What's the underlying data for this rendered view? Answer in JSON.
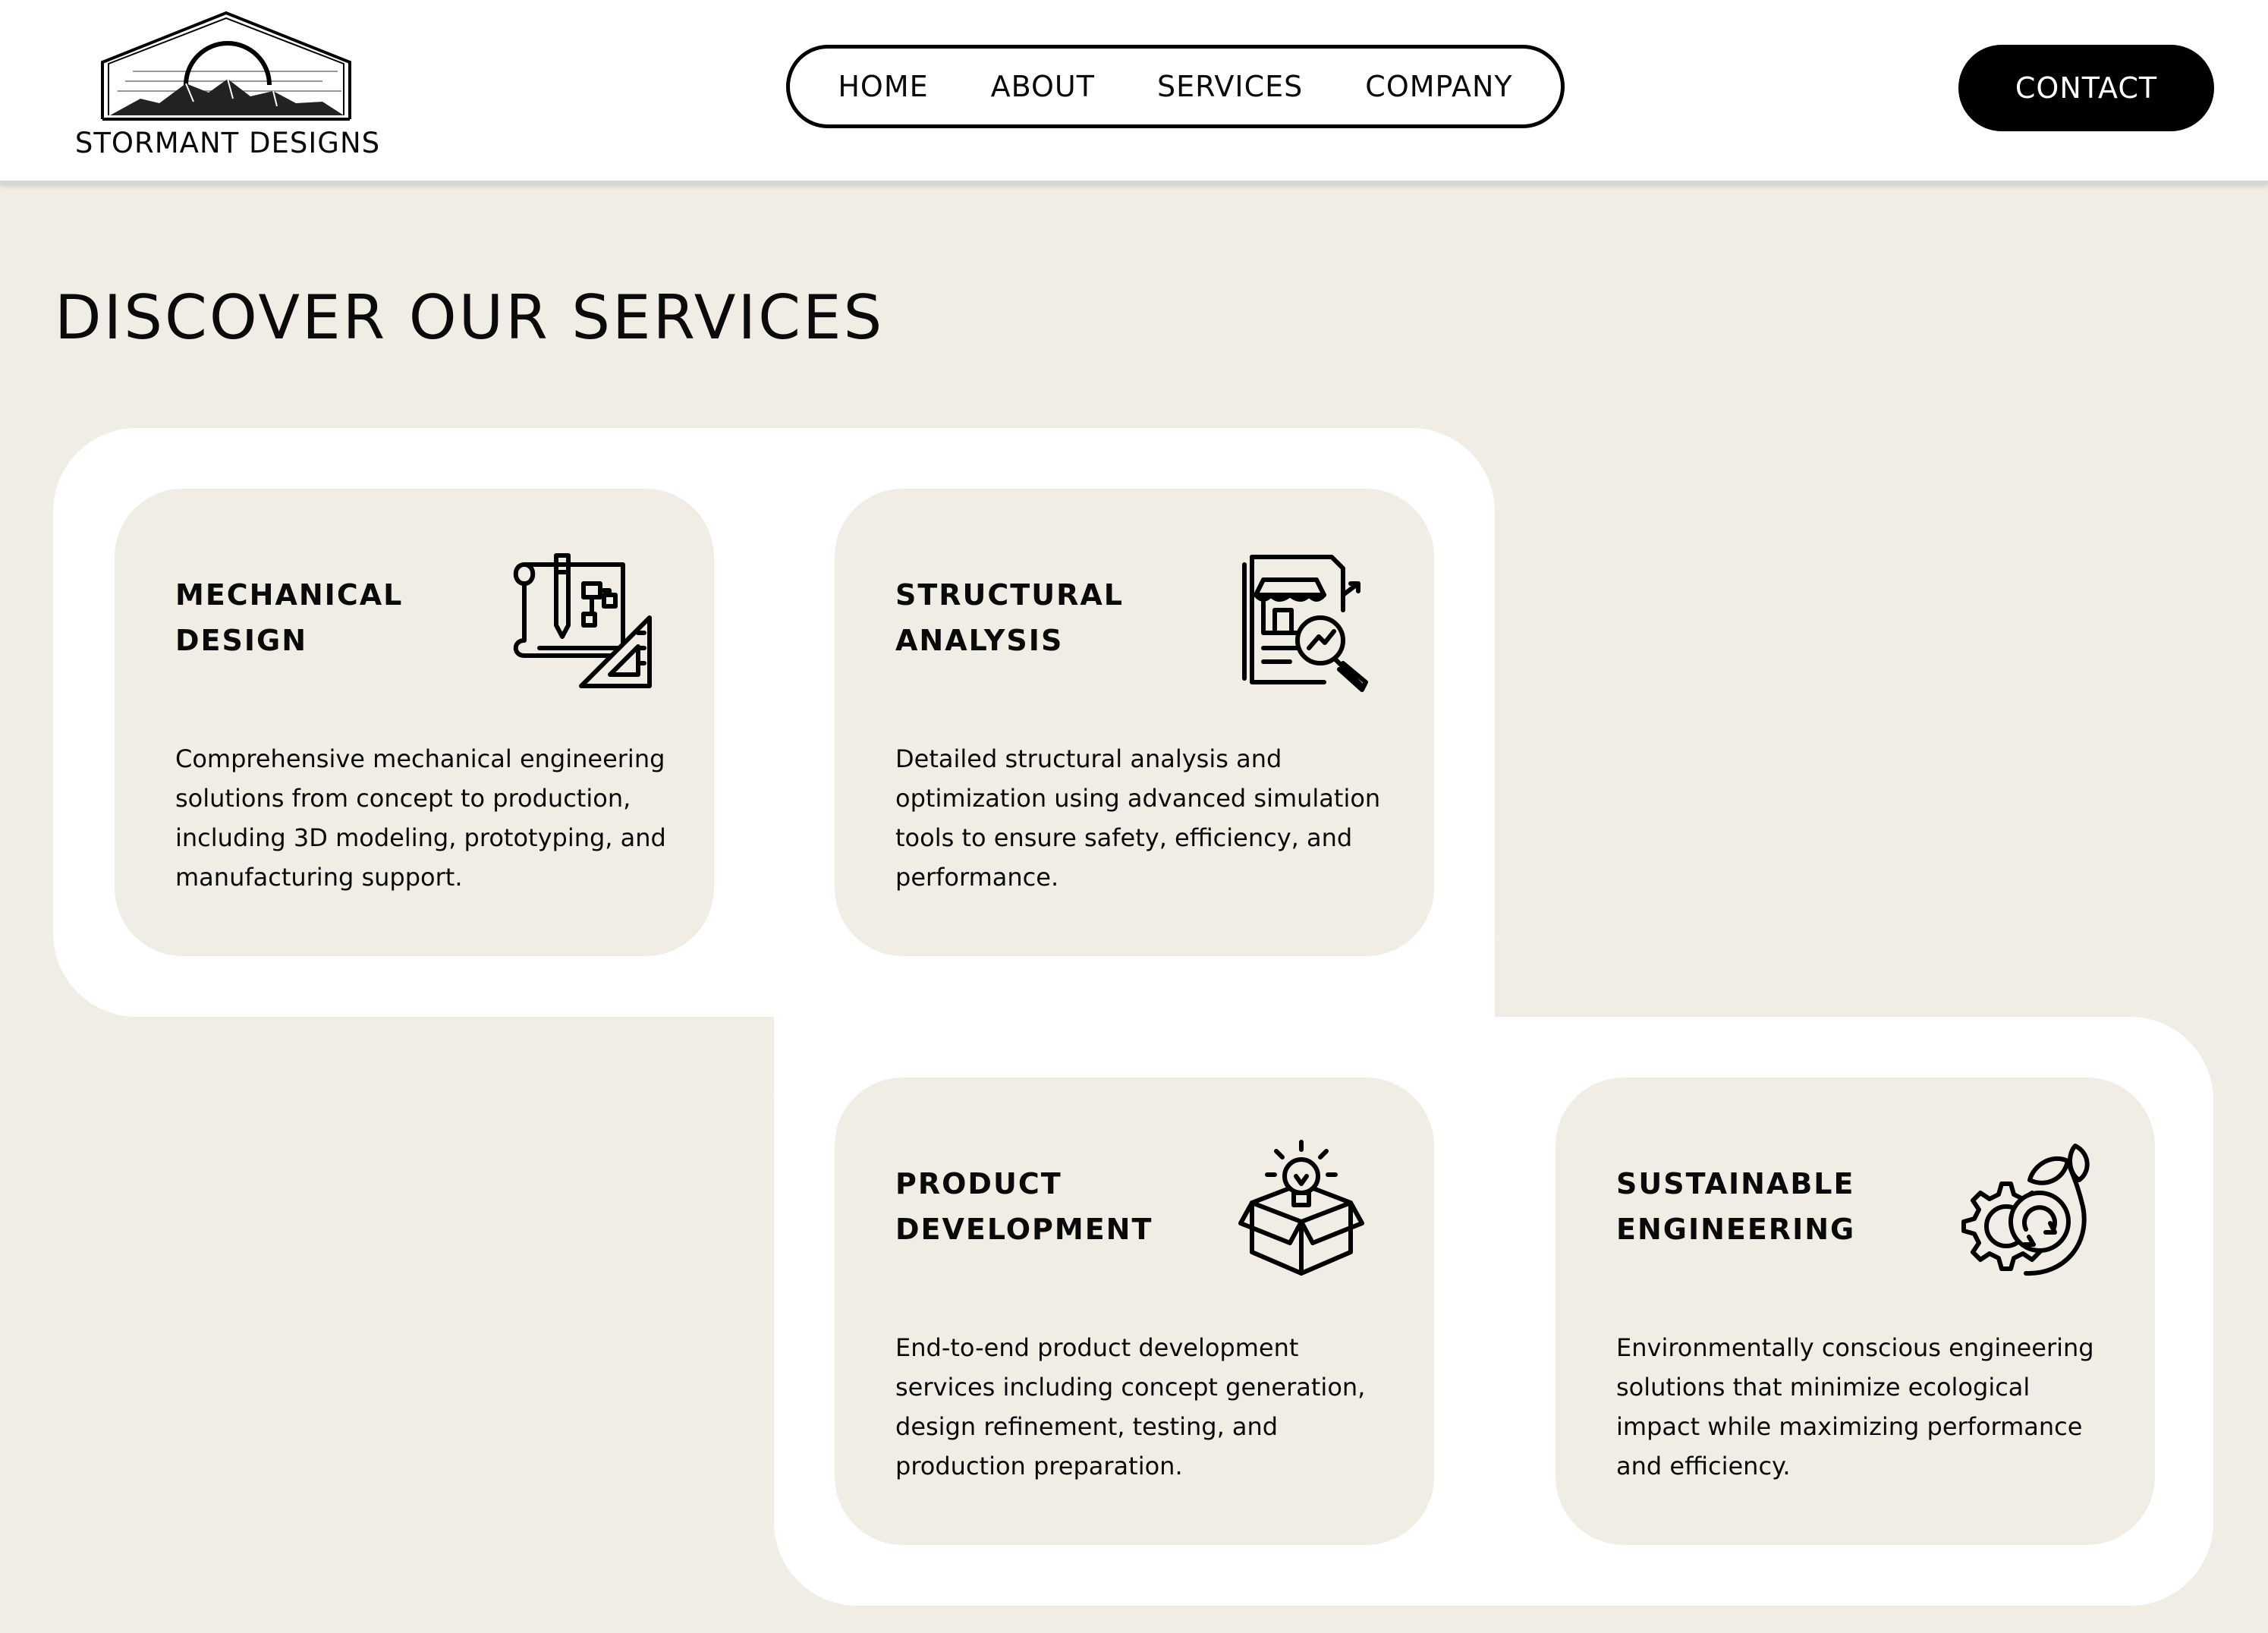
{
  "brand": {
    "name": "STORMANT DESIGNS"
  },
  "nav": {
    "items": [
      "HOME",
      "ABOUT",
      "SERVICES",
      "COMPANY"
    ]
  },
  "contact_label": "CONTACT",
  "page_title": "DISCOVER OUR SERVICES",
  "services": [
    {
      "title": "MECHANICAL DESIGN",
      "icon": "blueprint-icon",
      "description": "Comprehensive mechanical engineering solutions from concept to production, including 3D modeling, prototyping, and manufacturing support."
    },
    {
      "title": "STRUCTURAL ANALYSIS",
      "icon": "document-analysis-icon",
      "description": "Detailed structural analysis and optimization using advanced simulation tools to ensure safety, efficiency, and performance."
    },
    {
      "title": "PRODUCT DEVELOPMENT",
      "icon": "lightbulb-box-icon",
      "description": "End-to-end product development services including concept generation, design refinement, testing, and production preparation."
    },
    {
      "title": "SUSTAINABLE ENGINEERING",
      "icon": "gear-leaf-icon",
      "description": "Environmentally conscious engineering solutions that minimize ecological impact while maximizing performance and efficiency."
    }
  ],
  "colors": {
    "background": "#f0ede5",
    "panel": "#ffffff",
    "text": "#0a0a0a",
    "contact_button": "#000000"
  }
}
